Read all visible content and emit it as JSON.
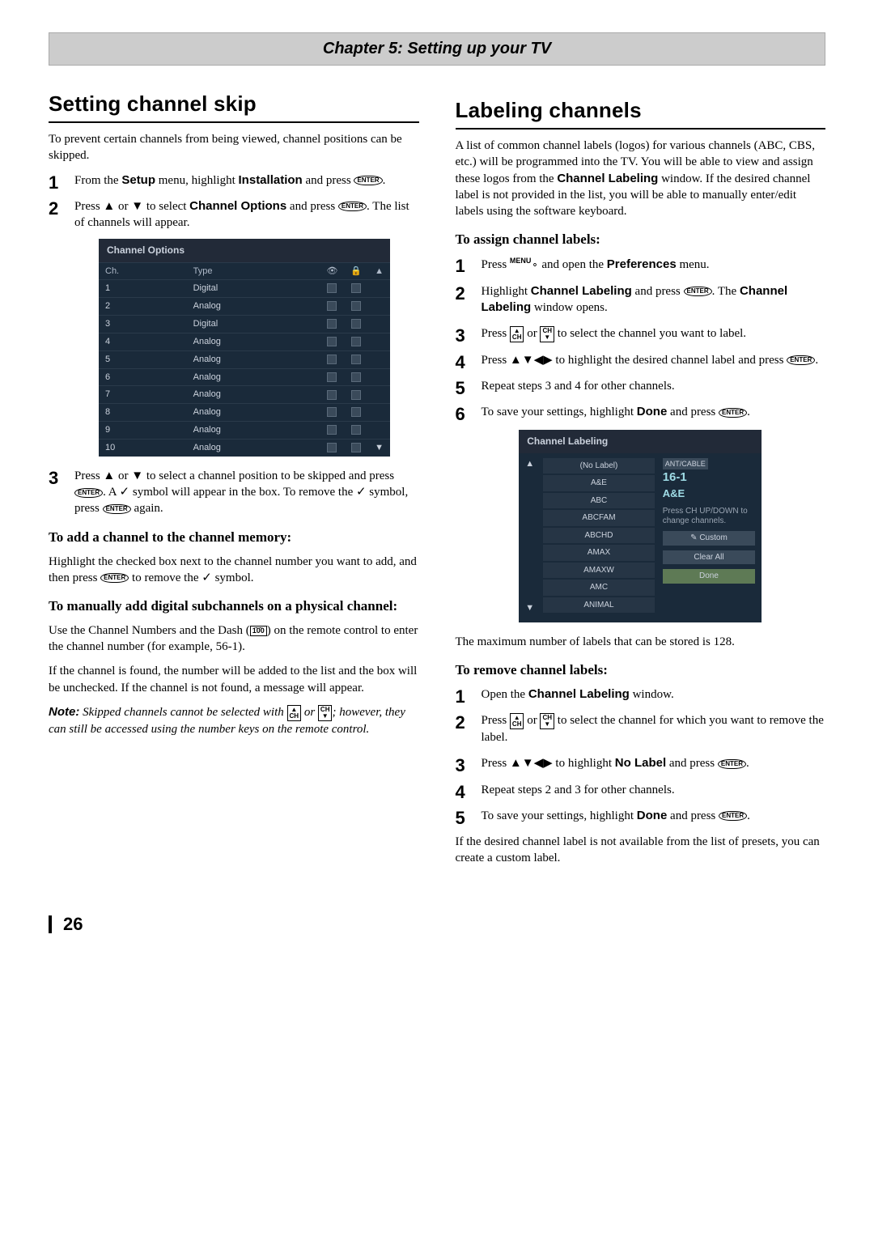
{
  "chapter": "Chapter 5: Setting up your TV",
  "page_number": "26",
  "left": {
    "title": "Setting channel skip",
    "intro": "To prevent certain channels from being viewed, channel positions can be skipped.",
    "steps": [
      {
        "pre": "From the ",
        "b1": "Setup",
        "mid1": " menu, highlight ",
        "b2": "Installation",
        "tail": " and press "
      },
      {
        "pre": "Press ▲ or ▼ to select ",
        "b1": "Channel Options",
        "tail": " and press ",
        "post": ". The list of channels will appear."
      },
      {
        "text": "Press ▲ or ▼ to select a channel position to be skipped and press ",
        "mid": ". A ✓ symbol will appear in the box. To remove the ✓ symbol, press ",
        "tail": " again."
      }
    ],
    "osd_title": "Channel Options",
    "osd_headers": {
      "ch": "Ch.",
      "type": "Type"
    },
    "osd_rows": [
      {
        "ch": "1",
        "type": "Digital"
      },
      {
        "ch": "2",
        "type": "Analog"
      },
      {
        "ch": "3",
        "type": "Digital"
      },
      {
        "ch": "4",
        "type": "Analog"
      },
      {
        "ch": "5",
        "type": "Analog"
      },
      {
        "ch": "6",
        "type": "Analog"
      },
      {
        "ch": "7",
        "type": "Analog"
      },
      {
        "ch": "8",
        "type": "Analog"
      },
      {
        "ch": "9",
        "type": "Analog"
      },
      {
        "ch": "10",
        "type": "Analog"
      }
    ],
    "sub1_title": "To add a channel to the channel memory:",
    "sub1_body_a": "Highlight the checked box next to the channel number you want to add, and then press ",
    "sub1_body_b": " to remove the ✓ symbol.",
    "sub2_title": "To manually add digital subchannels on a physical channel:",
    "sub2_body1_a": "Use the Channel Numbers and the Dash (",
    "sub2_body1_key": "1̄0̄0",
    "sub2_body1_b": ") on the remote control to enter the channel number (for example, 56-1).",
    "sub2_body2": "If the channel is found, the number will be added to the list and the box will be unchecked. If the channel is not found, a message will appear.",
    "note_label": "Note:",
    "note_a": " Skipped channels cannot be selected with ",
    "note_b": " or ",
    "note_c": "; however, they can still be accessed using the number keys on the remote control."
  },
  "right": {
    "title": "Labeling channels",
    "intro_a": "A list of common channel labels (logos) for various channels (ABC, CBS, etc.) will be programmed into the TV. You will be able to view and assign these logos from the ",
    "intro_bold": "Channel Labeling",
    "intro_b": " window. If the desired channel label is not provided in the list, you will be able to manually enter/edit labels using the software keyboard.",
    "assign_title": "To assign channel labels:",
    "assign_steps": {
      "s1_a": "Press ",
      "s1_menu": "MENU",
      "s1_b": " and open the ",
      "s1_bold": "Preferences",
      "s1_c": " menu.",
      "s2_a": "Highlight ",
      "s2_bold1": "Channel Labeling",
      "s2_b": " and press ",
      "s2_c": ". The ",
      "s2_bold2": "Channel Labeling",
      "s2_d": " window opens.",
      "s3_a": "Press ",
      "s3_b": " or ",
      "s3_c": " to select the channel you want to label.",
      "s4_a": "Press ▲▼◀▶ to highlight the desired channel label and press ",
      "s4_b": ".",
      "s5": "Repeat steps 3 and 4 for other channels.",
      "s6_a": "To save your settings, highlight ",
      "s6_bold": "Done",
      "s6_b": " and press "
    },
    "osd2_title": "Channel Labeling",
    "osd2_list": [
      "(No Label)",
      "A&E",
      "ABC",
      "ABCFAM",
      "ABCHD",
      "AMAX",
      "AMAXW",
      "AMC",
      "ANIMAL"
    ],
    "osd2_side": {
      "src_label": "ANT/CABLE",
      "chnum": "16-1",
      "chname": "A&E",
      "hint": "Press CH UP/DOWN to change channels.",
      "custom": "Custom",
      "clear": "Clear All",
      "done": "Done"
    },
    "max_note": "The maximum number of labels that can be stored is 128.",
    "remove_title": "To remove channel labels:",
    "remove_steps": {
      "s1_a": "Open the ",
      "s1_bold": "Channel Labeling",
      "s1_b": " window.",
      "s2_a": "Press ",
      "s2_b": " or ",
      "s2_c": " to select the channel for which you want to remove the label.",
      "s3_a": "Press ▲▼◀▶ to highlight ",
      "s3_bold": "No Label",
      "s3_b": " and press ",
      "s4": "Repeat steps 2 and 3 for other channels.",
      "s5_a": "To save your settings, highlight ",
      "s5_bold": "Done",
      "s5_b": " and press "
    },
    "tail": "If the desired channel label is not available from the list of presets, you can create a custom label."
  },
  "keys": {
    "enter": "ENTER",
    "ch_up": "▲\nCH",
    "ch_dn": "CH\n▼"
  }
}
